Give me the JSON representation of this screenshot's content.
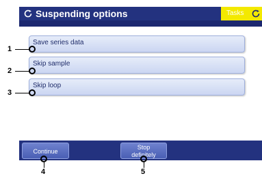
{
  "header": {
    "title": "Suspending options",
    "tasks_label": "Tasks"
  },
  "options": [
    {
      "label": "Save series data",
      "callout": "1"
    },
    {
      "label": "Skip sample",
      "callout": "2"
    },
    {
      "label": "Skip loop",
      "callout": "3"
    }
  ],
  "footer": {
    "continue_label": "Continue",
    "continue_callout": "4",
    "stop_label_line1": "Stop",
    "stop_label_line2": "definitely",
    "stop_callout": "5"
  },
  "colors": {
    "header_bg": "#23327f",
    "tasks_bg": "#f3e900",
    "option_text": "#1f2c6a"
  },
  "icons": {
    "title": "refresh-icon",
    "tasks": "refresh-icon"
  }
}
